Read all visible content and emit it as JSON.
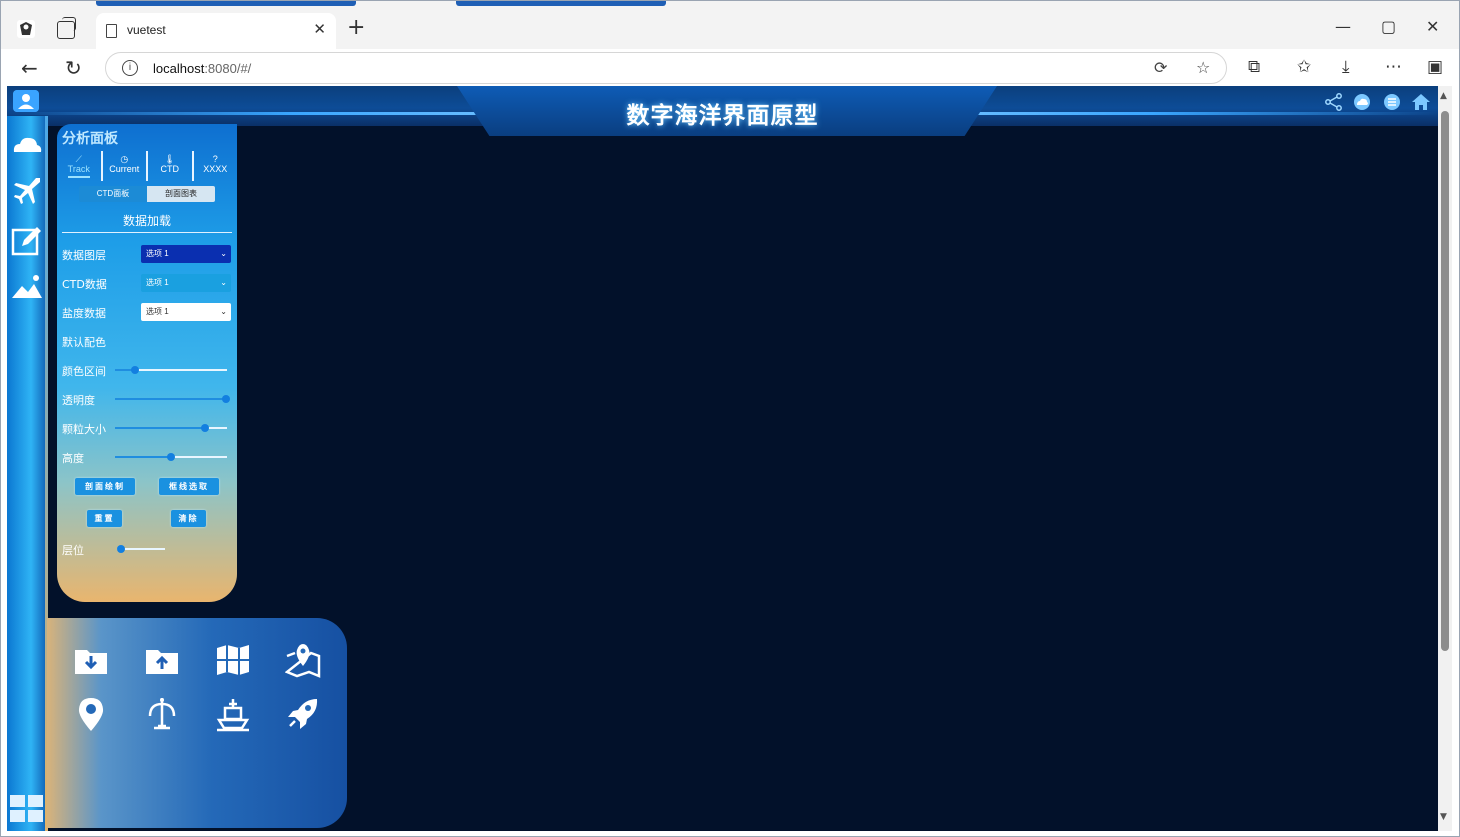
{
  "browser": {
    "tab_title": "vuetest",
    "tab_close": "✕",
    "new_tab": "+",
    "url_host": "localhost",
    "url_path": ":8080/#/",
    "win_min": "—",
    "win_max": "▢",
    "win_close": "✕"
  },
  "app": {
    "title": "数字海洋界面原型",
    "header_icons": [
      "share-icon",
      "cloud-icon",
      "list-icon",
      "home-icon"
    ],
    "left_icons": [
      "cloud-icon",
      "plane-icon",
      "edit-icon",
      "terrain-icon",
      "grid-icon"
    ]
  },
  "panel": {
    "title": "分析面板",
    "tabs": [
      {
        "glyph": "⟋",
        "label": "Track"
      },
      {
        "glyph": "◷",
        "label": "Current"
      },
      {
        "glyph": "🌡",
        "label": "CTD"
      },
      {
        "glyph": "?",
        "label": "XXXX"
      }
    ],
    "subtabs": [
      "CTD面板",
      "剖面图表"
    ],
    "section": "数据加载",
    "rows": {
      "data_layer": {
        "label": "数据图层",
        "value": "选项 1"
      },
      "ctd_data": {
        "label": "CTD数据",
        "value": "选项 1"
      },
      "salinity": {
        "label": "盐度数据",
        "value": "选项 1"
      },
      "default_color": {
        "label": "默认配色"
      },
      "color_range": {
        "label": "颜色区间",
        "value": 0.15
      },
      "opacity": {
        "label": "透明度",
        "value": 1.0
      },
      "particle_size": {
        "label": "颗粒大小",
        "value": 0.8
      },
      "height": {
        "label": "高度",
        "value": 0.5
      },
      "level": {
        "label": "层位",
        "value": 0.0
      }
    },
    "buttons": {
      "profile_draw": "剖面绘制",
      "box_select": "框线选取",
      "reset": "重置",
      "clear": "清除"
    },
    "colors": {
      "accent": "#1a91e0",
      "select_dark": "#0a2fb0",
      "select_mid": "#1aa0e0"
    }
  },
  "tools": [
    "folder-download-icon",
    "folder-upload-icon",
    "map-grid-icon",
    "map-pin-icon",
    "location-icon",
    "buoy-icon",
    "ship-icon",
    "rocket-icon"
  ]
}
